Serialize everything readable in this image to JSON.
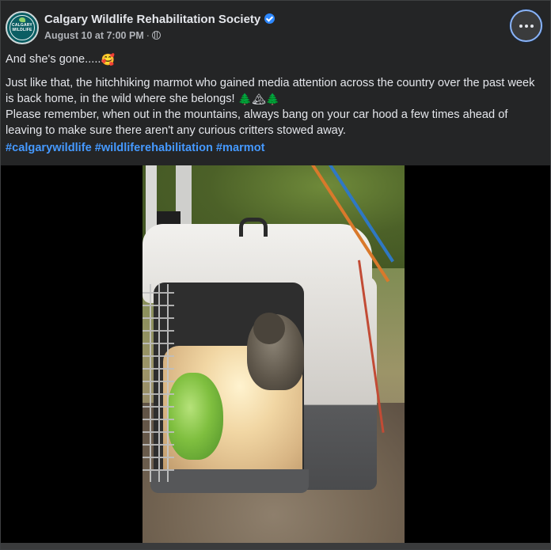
{
  "post": {
    "page_name": "Calgary Wildlife Rehabilitation Society",
    "verified_icon": "verified-badge-icon",
    "timestamp": "August 10 at 7:00 PM",
    "separator": "·",
    "audience_icon": "globe-icon",
    "more_icon": "more-options-icon",
    "avatar": {
      "line1": "CALGARY",
      "line2": "WILDLIFE"
    },
    "text": {
      "line1": "And she's gone.....",
      "line1_emoji": "🥰",
      "paragraph2": "Just like that, the hitchhiking marmot who gained media attention across the country over the past week is back home, in the wild where she belongs! ",
      "paragraph2_emoji": [
        "🌲",
        "🏔",
        "🌲"
      ],
      "paragraph3": "Please remember, when out in the mountains, always bang on your car hood a few times ahead of leaving to make sure there aren't any curious critters stowed away."
    },
    "hashtags": [
      "#calgarywildlife",
      "#wildliferehabilitation",
      "#marmot"
    ]
  },
  "media": {
    "type": "video",
    "subject": "marmot in open pet carrier on grass"
  },
  "colors": {
    "card_bg": "#242526",
    "text": "#e4e6eb",
    "secondary_text": "#b0b3b8",
    "link": "#4599ff",
    "verified": "#2d88ff"
  }
}
